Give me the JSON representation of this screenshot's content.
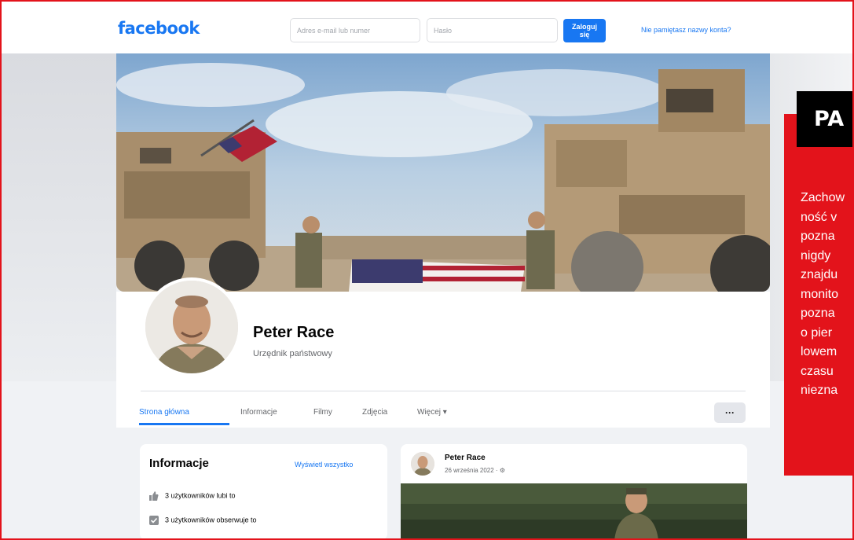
{
  "header": {
    "logo": "facebook",
    "email_placeholder": "Adres e-mail lub numer",
    "password_placeholder": "Hasło",
    "login_label": "Zaloguj się",
    "forgot_label": "Nie pamiętasz nazwy konta?"
  },
  "profile": {
    "name": "Peter Race",
    "subtitle": "Urzędnik państwowy"
  },
  "tabs": [
    {
      "label": "Strona główna",
      "active": true
    },
    {
      "label": "Informacje"
    },
    {
      "label": "Filmy"
    },
    {
      "label": "Zdjęcia"
    },
    {
      "label": "Więcej ▾"
    }
  ],
  "more_button": "···",
  "info": {
    "title": "Informacje",
    "see_all": "Wyświetl wszystko",
    "rows": [
      {
        "text": "3 użytkowników lubi to",
        "icon": "thumbs-up-icon"
      },
      {
        "text": "3 użytkowników obserwuje to",
        "icon": "follow-check-icon"
      }
    ]
  },
  "post": {
    "author": "Peter Race",
    "date": "26 września 2022 · ⚙"
  },
  "side_panel": {
    "label": "PA",
    "lines": [
      "Zachow",
      "ność v",
      "pozna",
      "nigdy",
      "znajdu",
      "monito",
      "pozna",
      "o pier",
      "lowem",
      "czasu",
      "niezna"
    ]
  },
  "colors": {
    "facebook_blue": "#1877f2",
    "frame_red": "#e3131b",
    "page_bg": "#f0f2f5"
  }
}
